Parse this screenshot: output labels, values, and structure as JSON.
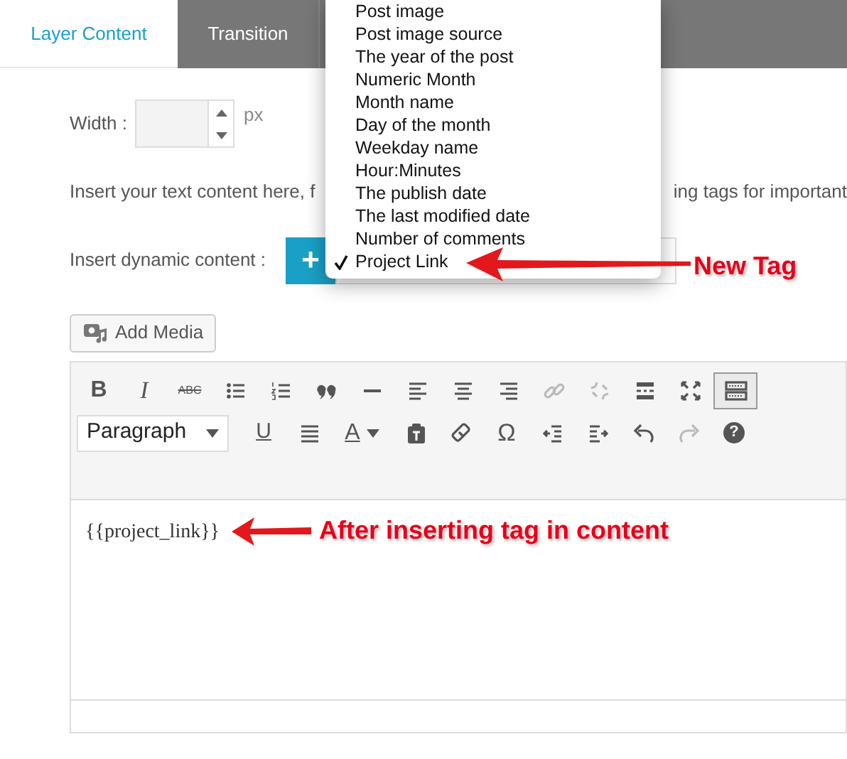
{
  "tabs": [
    {
      "label": "Layer Content",
      "selected": true
    },
    {
      "label": "Transition",
      "selected": false
    }
  ],
  "width_field": {
    "label": "Width :",
    "unit": "px"
  },
  "hint": {
    "before": "Insert your text content here, f",
    "after": "ing tags for important"
  },
  "dynamic_content": {
    "label": "Insert dynamic content :",
    "button": "+"
  },
  "dropdown": {
    "items": [
      {
        "label": "Post image",
        "selected": false
      },
      {
        "label": "Post image source",
        "selected": false
      },
      {
        "label": "The year of the post",
        "selected": false
      },
      {
        "label": "Numeric Month",
        "selected": false
      },
      {
        "label": "Month name",
        "selected": false
      },
      {
        "label": "Day of the month",
        "selected": false
      },
      {
        "label": "Weekday name",
        "selected": false
      },
      {
        "label": "Hour:Minutes",
        "selected": false
      },
      {
        "label": "The publish date",
        "selected": false
      },
      {
        "label": "The last modified date",
        "selected": false
      },
      {
        "label": "Number of comments",
        "selected": false
      },
      {
        "label": "Project Link",
        "selected": true
      }
    ]
  },
  "dropdown_annotation": "New Tag",
  "add_media": "Add Media",
  "editor": {
    "toolbar_rows": [
      [
        {
          "kind": "bold",
          "text": "B",
          "disabled": false
        },
        {
          "kind": "italic",
          "text": "I",
          "disabled": false
        },
        {
          "kind": "strike",
          "text": "ABC",
          "disabled": false
        },
        {
          "kind": "bullets",
          "disabled": false
        },
        {
          "kind": "numbers",
          "disabled": false
        },
        {
          "kind": "quote",
          "disabled": false
        },
        {
          "kind": "rule",
          "disabled": false
        },
        {
          "kind": "align-left",
          "disabled": false
        },
        {
          "kind": "align-center",
          "disabled": false
        },
        {
          "kind": "align-right",
          "disabled": false
        },
        {
          "kind": "link",
          "disabled": true
        },
        {
          "kind": "unlink",
          "disabled": true
        },
        {
          "kind": "readmore",
          "disabled": false
        },
        {
          "kind": "fullscreen",
          "disabled": false
        },
        {
          "kind": "toolbar-toggle",
          "disabled": false,
          "selected": true
        }
      ],
      [
        {
          "kind": "select",
          "text": "Paragraph",
          "disabled": false
        },
        {
          "kind": "underline",
          "text": "U",
          "disabled": false
        },
        {
          "kind": "justify",
          "disabled": false
        },
        {
          "kind": "text-color",
          "text": "A",
          "disabled": false
        },
        {
          "kind": "paste-text",
          "disabled": false
        },
        {
          "kind": "eraser",
          "disabled": false
        },
        {
          "kind": "symbol",
          "text": "Ω",
          "disabled": false
        },
        {
          "kind": "outdent",
          "disabled": false
        },
        {
          "kind": "indent",
          "disabled": false
        },
        {
          "kind": "undo",
          "disabled": false
        },
        {
          "kind": "redo",
          "disabled": true
        },
        {
          "kind": "help",
          "text": "?",
          "disabled": false
        }
      ]
    ],
    "content": "{{project_link}}",
    "content_annotation": "After inserting tag in content"
  }
}
